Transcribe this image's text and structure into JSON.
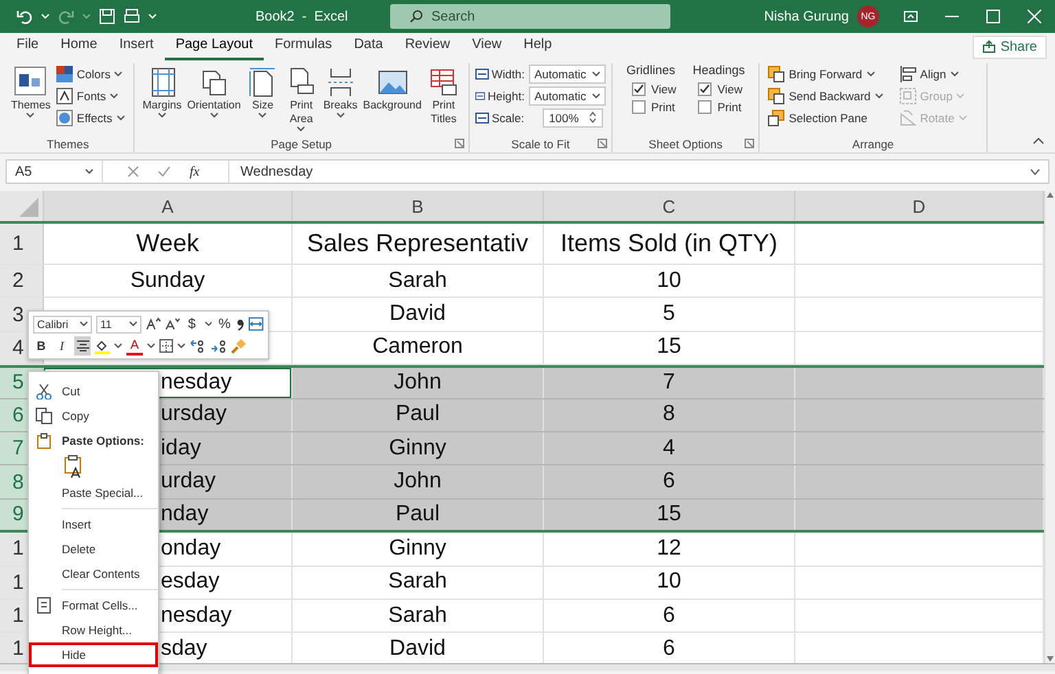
{
  "title_bar": {
    "title": "Book2  -  Excel",
    "search": {
      "placeholder": "Search"
    },
    "user": "Nisha Gurung",
    "avatar": "NG"
  },
  "tabs": [
    {
      "label": "File",
      "selected": false
    },
    {
      "label": "Home",
      "selected": false
    },
    {
      "label": "Insert",
      "selected": false
    },
    {
      "label": "Page Layout",
      "selected": true
    },
    {
      "label": "Formulas",
      "selected": false
    },
    {
      "label": "Data",
      "selected": false
    },
    {
      "label": "Review",
      "selected": false
    },
    {
      "label": "View",
      "selected": false
    },
    {
      "label": "Help",
      "selected": false
    }
  ],
  "share": "Share",
  "themes": {
    "label": "Themes",
    "button": "Themes",
    "items": [
      "Colors",
      "Fonts",
      "Effects"
    ]
  },
  "page_setup": {
    "label": "Page Setup",
    "buttons": [
      {
        "label": "Margins",
        "has_menu": true
      },
      {
        "label": "Orientation",
        "has_menu": true
      },
      {
        "label": "Size",
        "has_menu": true
      },
      {
        "label": "Print Area",
        "has_menu": true
      },
      {
        "label": "Breaks",
        "has_menu": true
      },
      {
        "label": "Background",
        "has_menu": false
      },
      {
        "label": "Print Titles",
        "has_menu": false
      }
    ]
  },
  "scale_to_fit": {
    "label": "Scale to Fit",
    "fields": [
      {
        "label": "Width:",
        "value": "Automatic",
        "kind": "dropdown"
      },
      {
        "label": "Height:",
        "value": "Automatic",
        "kind": "dropdown"
      },
      {
        "label": "Scale:",
        "value": "100%",
        "kind": "spinner"
      }
    ]
  },
  "sheet_options": {
    "label": "Sheet Options",
    "columns": [
      {
        "title": "Gridlines",
        "options": [
          {
            "label": "View",
            "checked": true
          },
          {
            "label": "Print",
            "checked": false
          }
        ]
      },
      {
        "title": "Headings",
        "options": [
          {
            "label": "View",
            "checked": true
          },
          {
            "label": "Print",
            "checked": false
          }
        ]
      }
    ]
  },
  "arrange": {
    "label": "Arrange",
    "items": [
      {
        "label": "Bring Forward",
        "disabled": false,
        "has_menu": true
      },
      {
        "label": "Send Backward",
        "disabled": false,
        "has_menu": true
      },
      {
        "label": "Selection Pane",
        "disabled": false,
        "has_menu": false
      },
      {
        "label": "Align",
        "disabled": false,
        "has_menu": true
      },
      {
        "label": "Group",
        "disabled": true,
        "has_menu": true
      },
      {
        "label": "Rotate",
        "disabled": true,
        "has_menu": true
      }
    ]
  },
  "formula_bar": {
    "name_box": "A5",
    "function_label": "fx",
    "formula": "Wednesday"
  },
  "grid": {
    "columns": [
      "A",
      "B",
      "C",
      "D"
    ],
    "rows": [
      {
        "number": "1",
        "selected": false,
        "cells": [
          {
            "text": "Week",
            "clipped": false,
            "active": false
          },
          {
            "text": "Sales Representativ",
            "clipped": false,
            "active": false
          },
          {
            "text": "Items Sold (in QTY)",
            "clipped": false,
            "active": false
          }
        ]
      },
      {
        "number": "2",
        "selected": false,
        "cells": [
          {
            "text": "Sunday",
            "clipped": false,
            "active": false
          },
          {
            "text": "Sarah",
            "clipped": false,
            "active": false
          },
          {
            "text": "10",
            "clipped": false,
            "active": false
          }
        ]
      },
      {
        "number": "3",
        "selected": false,
        "cells": [
          null,
          {
            "text": "David",
            "clipped": false,
            "active": false
          },
          {
            "text": "5",
            "clipped": false,
            "active": false
          }
        ]
      },
      {
        "number": "4",
        "selected": false,
        "cells": [
          null,
          {
            "text": "Cameron",
            "clipped": false,
            "active": false
          },
          {
            "text": "15",
            "clipped": false,
            "active": false
          }
        ]
      },
      {
        "number": "5",
        "selected": true,
        "cells": [
          {
            "text": "nesday",
            "clipped": true,
            "active": true
          },
          {
            "text": "John",
            "clipped": false,
            "active": false
          },
          {
            "text": "7",
            "clipped": false,
            "active": false
          }
        ]
      },
      {
        "number": "6",
        "selected": true,
        "cells": [
          {
            "text": "ursday",
            "clipped": true,
            "active": false
          },
          {
            "text": "Paul",
            "clipped": false,
            "active": false
          },
          {
            "text": "8",
            "clipped": false,
            "active": false
          }
        ]
      },
      {
        "number": "7",
        "selected": true,
        "cells": [
          {
            "text": "iday",
            "clipped": true,
            "active": false
          },
          {
            "text": "Ginny",
            "clipped": false,
            "active": false
          },
          {
            "text": "4",
            "clipped": false,
            "active": false
          }
        ]
      },
      {
        "number": "8",
        "selected": true,
        "cells": [
          {
            "text": "urday",
            "clipped": true,
            "active": false
          },
          {
            "text": "John",
            "clipped": false,
            "active": false
          },
          {
            "text": "6",
            "clipped": false,
            "active": false
          }
        ]
      },
      {
        "number": "9",
        "selected": true,
        "cells": [
          {
            "text": "nday",
            "clipped": true,
            "active": false
          },
          {
            "text": "Paul",
            "clipped": false,
            "active": false
          },
          {
            "text": "15",
            "clipped": false,
            "active": false
          }
        ]
      },
      {
        "number": "1",
        "selected": false,
        "cells": [
          {
            "text": "onday",
            "clipped": true,
            "active": false
          },
          {
            "text": "Ginny",
            "clipped": false,
            "active": false
          },
          {
            "text": "12",
            "clipped": false,
            "active": false
          }
        ]
      },
      {
        "number": "1",
        "selected": false,
        "cells": [
          {
            "text": "esday",
            "clipped": true,
            "active": false
          },
          {
            "text": "Sarah",
            "clipped": false,
            "active": false
          },
          {
            "text": "10",
            "clipped": false,
            "active": false
          }
        ]
      },
      {
        "number": "1",
        "selected": false,
        "cells": [
          {
            "text": "nesday",
            "clipped": true,
            "active": false
          },
          {
            "text": "Sarah",
            "clipped": false,
            "active": false
          },
          {
            "text": "6",
            "clipped": false,
            "active": false
          }
        ]
      },
      {
        "number": "1",
        "selected": false,
        "cells": [
          {
            "text": "sday",
            "clipped": true,
            "active": false
          },
          {
            "text": "David",
            "clipped": false,
            "active": false
          },
          {
            "text": "6",
            "clipped": false,
            "active": false
          }
        ]
      }
    ]
  },
  "mini_toolbar": {
    "font": "Calibri",
    "size": "11",
    "currency": "$",
    "percent": "%",
    "bold": "B",
    "italic": "I",
    "font_color": "A",
    "align_center": {
      "selected": true
    }
  },
  "context_menu": {
    "items": [
      {
        "kind": "item",
        "label": "Cut",
        "highlighted": false
      },
      {
        "kind": "item",
        "label": "Copy",
        "highlighted": false
      },
      {
        "kind": "header",
        "label": "Paste Options:",
        "highlighted": false
      },
      {
        "kind": "paste-option",
        "highlighted": false
      },
      {
        "kind": "item",
        "label": "Paste Special...",
        "highlighted": false
      },
      {
        "kind": "separator",
        "highlighted": false
      },
      {
        "kind": "item",
        "label": "Insert",
        "highlighted": false
      },
      {
        "kind": "item",
        "label": "Delete",
        "highlighted": false
      },
      {
        "kind": "item",
        "label": "Clear Contents",
        "highlighted": false
      },
      {
        "kind": "separator",
        "highlighted": false
      },
      {
        "kind": "item",
        "label": "Format Cells...",
        "highlighted": false
      },
      {
        "kind": "item",
        "label": "Row Height...",
        "highlighted": false
      },
      {
        "kind": "item",
        "label": "Hide",
        "highlighted": true
      }
    ]
  }
}
